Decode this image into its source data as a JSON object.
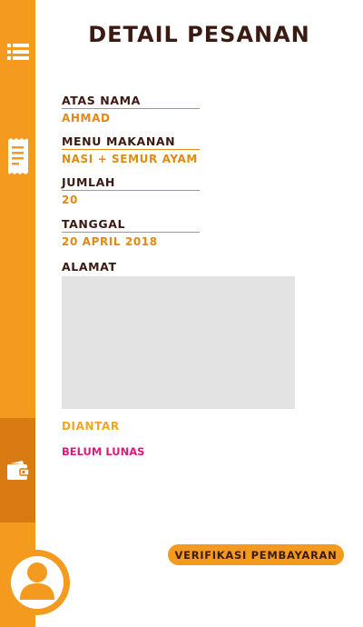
{
  "page": {
    "title": "DETAIL PESANAN"
  },
  "order": {
    "fields": [
      {
        "label": "ATAS NAMA",
        "value": "AHMAD"
      },
      {
        "label": "MENU MAKANAN",
        "value": "NASI + SEMUR AYAM"
      },
      {
        "label": "JUMLAH",
        "value": "20"
      },
      {
        "label": "TANGGAL",
        "value": "20 APRIL 2018"
      }
    ],
    "address_label": "ALAMAT",
    "address_value": "",
    "delivery_status": "DIANTAR",
    "payment_status": "BELUM LUNAS"
  },
  "actions": {
    "verify_label": "VERIFIKASI PEMBAYARAN"
  },
  "sidebar": {
    "items": [
      {
        "icon": "list-icon"
      },
      {
        "icon": "receipt-icon"
      },
      {
        "icon": "wallet-icon",
        "active": true
      }
    ],
    "profile_icon": "user-icon"
  },
  "colors": {
    "accent": "#f39a1f",
    "accent_dark": "#d97a12",
    "title": "#3b1a12",
    "value": "#e08a13",
    "unpaid": "#d81b7a",
    "address_bg": "#e3e3e3"
  }
}
